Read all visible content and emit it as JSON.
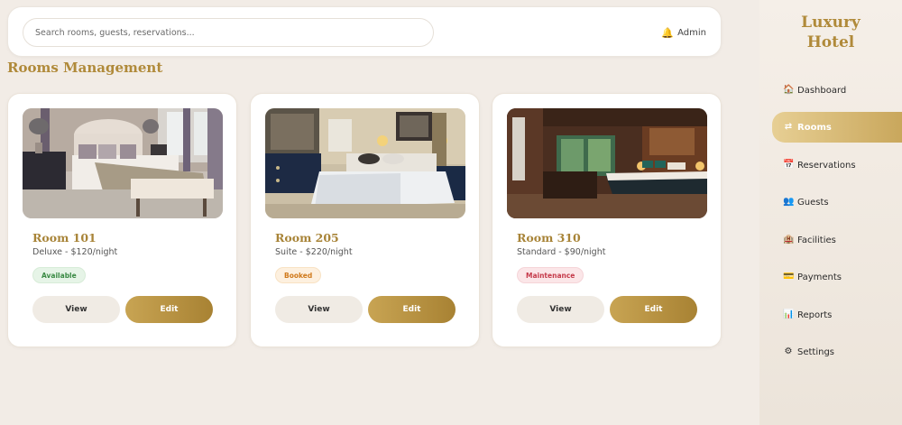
{
  "header": {
    "search_placeholder": "Search rooms, guests, reservations...",
    "user_label": "Admin",
    "bell_icon": "bell-icon"
  },
  "page": {
    "title": "Rooms Management"
  },
  "rooms": [
    {
      "name": "Room 101",
      "description": "Deluxe - $120/night",
      "status": "Available",
      "view_label": "View",
      "edit_label": "Edit"
    },
    {
      "name": "Room 205",
      "description": "Suite - $220/night",
      "status": "Booked",
      "view_label": "View",
      "edit_label": "Edit"
    },
    {
      "name": "Room 310",
      "description": "Standard - $90/night",
      "status": "Maintenance",
      "view_label": "View",
      "edit_label": "Edit"
    }
  ],
  "sidebar": {
    "brand_line1": "Luxury",
    "brand_line2": "Hotel",
    "items": [
      {
        "label": "Dashboard",
        "icon": "house-icon"
      },
      {
        "label": "Rooms",
        "icon": "swap-arrows-icon"
      },
      {
        "label": "Reservations",
        "icon": "calendar-icon"
      },
      {
        "label": "Guests",
        "icon": "people-icon"
      },
      {
        "label": "Facilities",
        "icon": "building-icon"
      },
      {
        "label": "Payments",
        "icon": "credit-card-icon"
      },
      {
        "label": "Reports",
        "icon": "bar-chart-icon"
      },
      {
        "label": "Settings",
        "icon": "gear-icon"
      }
    ],
    "active_item": "Rooms"
  },
  "colors": {
    "accent": "#b08a3a",
    "edit_button": "#b8923f",
    "available": "#3a8a44",
    "booked": "#d07a1c",
    "maintenance": "#c53a4a"
  }
}
